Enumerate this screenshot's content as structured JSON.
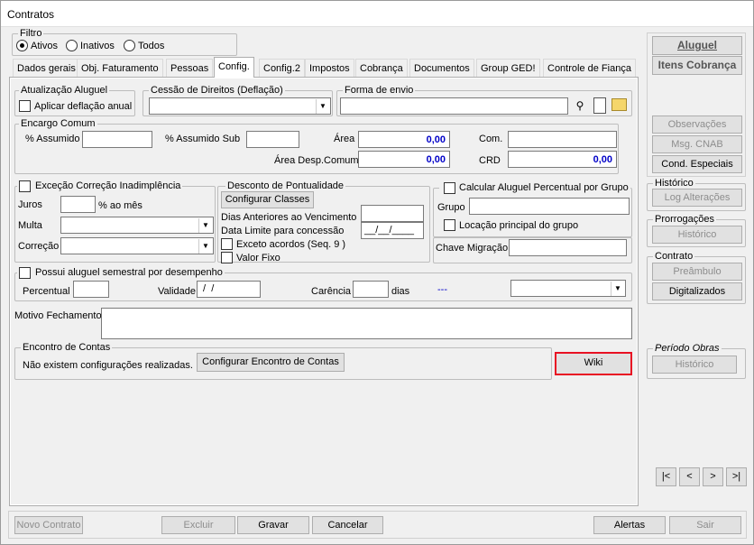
{
  "window": {
    "title": "Contratos"
  },
  "filter": {
    "legend": "Filtro",
    "options": [
      "Ativos",
      "Inativos",
      "Todos"
    ]
  },
  "tabs": [
    "Dados gerais",
    "Obj. Faturamento",
    "Pessoas",
    "Config.",
    "Config.2",
    "Impostos",
    "Cobrança",
    "Documentos",
    "Group GED!",
    "Controle de Fiança"
  ],
  "atualizacao": {
    "legend": "Atualização Aluguel",
    "aplicar": "Aplicar deflação anual"
  },
  "cessao": {
    "legend": "Cessão de Direitos (Deflação)"
  },
  "forma": {
    "legend": "Forma de envio"
  },
  "encargo": {
    "legend": "Encargo Comum",
    "assumido": "% Assumido",
    "assumido_sub": "% Assumido Sub",
    "area": "Área",
    "area_val": "0,00",
    "com": "Com.",
    "area_desp": "Área Desp.Comum",
    "area_desp_val": "0,00",
    "crd": "CRD",
    "crd_val": "0,00"
  },
  "excecao": {
    "legend": "Exceção Correção Inadimplência",
    "juros": "Juros",
    "ao_mes": "% ao mês",
    "multa": "Multa",
    "correcao": "Correção"
  },
  "desconto": {
    "legend": "Desconto de Pontualidade",
    "configurar": "Configurar Classes",
    "dias": "Dias Anteriores ao Vencimento",
    "data_limite": "Data Limite para concessão",
    "data_val": "__/__/____",
    "exceto": "Exceto acordos (Seq. 9 )",
    "valor_fixo": "Valor Fixo"
  },
  "calc": {
    "legend": "Calcular Aluguel Percentual por Grupo",
    "grupo": "Grupo",
    "locacao": "Locação principal do grupo",
    "chave": "Chave Migração"
  },
  "semestral": {
    "legend": "Possui aluguel semestral por desempenho",
    "percentual": "Percentual",
    "validade": "Validade",
    "validade_val": " /  /",
    "carencia": "Carência",
    "dias": "dias",
    "dash": "---"
  },
  "motivo": {
    "label": "Motivo Fechamento"
  },
  "encontro": {
    "legend": "Encontro de Contas",
    "msg": "Não existem configurações realizadas.",
    "btn": "Configurar Encontro de Contas",
    "wiki": "Wiki"
  },
  "side": {
    "aluguel": "Aluguel",
    "itens": "Itens Cobrança",
    "observacoes": "Observações",
    "msg_cnab": "Msg. CNAB",
    "cond": "Cond. Especiais",
    "historico_leg": "Histórico",
    "log": "Log Alterações",
    "prorrog_leg": "Prorrogações",
    "prorrog_hist": "Histórico",
    "contrato_leg": "Contrato",
    "preambulo": "Preâmbulo",
    "digitalizados": "Digitalizados",
    "periodo_leg": "Período Obras",
    "periodo_hist": "Histórico"
  },
  "nav": [
    "|<",
    "<",
    ">",
    ">|"
  ],
  "bottom": {
    "novo": "Novo Contrato",
    "excluir": "Excluir",
    "gravar": "Gravar",
    "cancelar": "Cancelar",
    "alertas": "Alertas",
    "sair": "Sair"
  },
  "colors": {
    "accent_number": "#0000c8",
    "wiki_border": "#e81123"
  }
}
